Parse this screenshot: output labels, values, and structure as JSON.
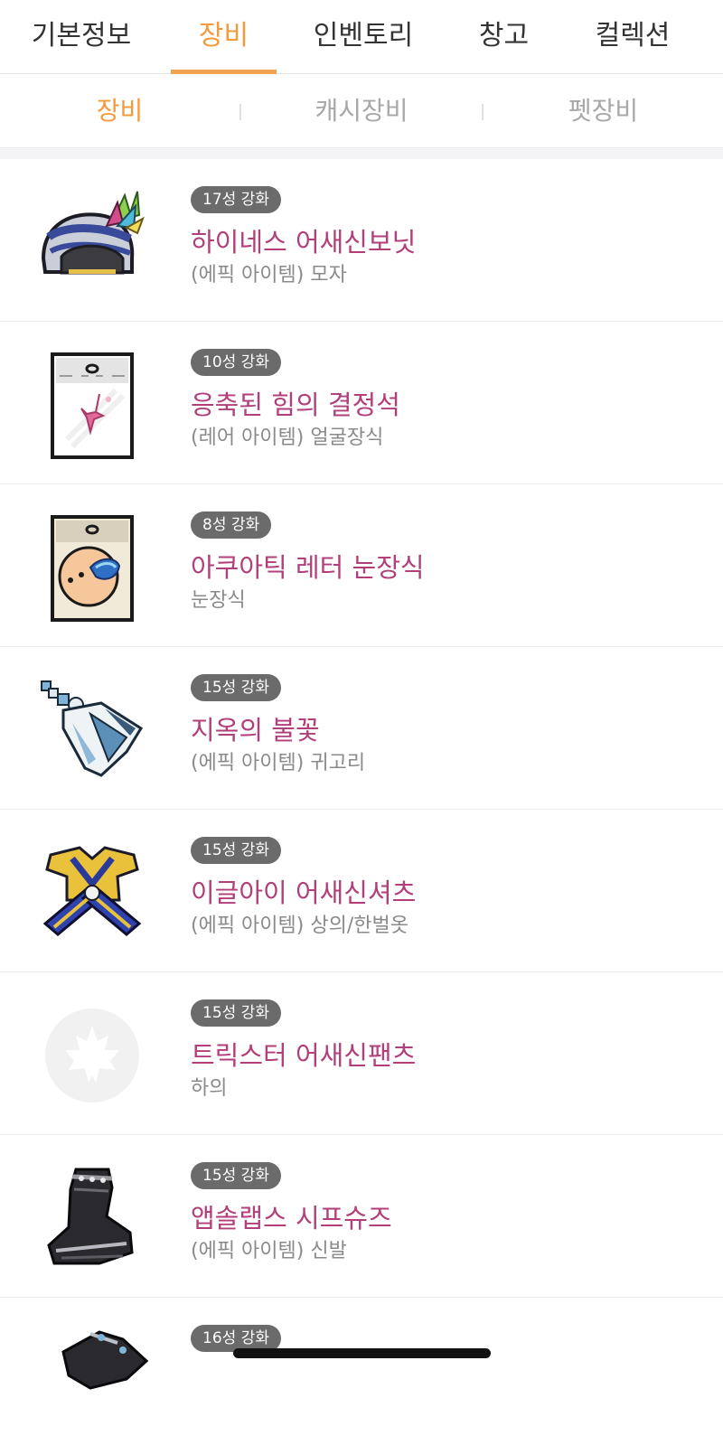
{
  "top_tabs": [
    {
      "label": "기본정보"
    },
    {
      "label": "장비"
    },
    {
      "label": "인벤토리"
    },
    {
      "label": "창고"
    },
    {
      "label": "컬렉션"
    }
  ],
  "top_tabs_active": "장비",
  "sub_tabs": [
    {
      "label": "장비"
    },
    {
      "label": "캐시장비"
    },
    {
      "label": "펫장비"
    }
  ],
  "sub_tabs_active": "장비",
  "items": [
    {
      "badge": "17성 강화",
      "name": "하이네스 어새신보닛",
      "type": "(에픽 아이템) 모자",
      "icon": "helmet-icon"
    },
    {
      "badge": "10성 강화",
      "name": "응축된 힘의 결정석",
      "type": "(레어 아이템) 얼굴장식",
      "icon": "crystal-card-icon"
    },
    {
      "badge": "8성 강화",
      "name": "아쿠아틱 레터 눈장식",
      "type": "눈장식",
      "icon": "eye-accessory-icon"
    },
    {
      "badge": "15성 강화",
      "name": "지옥의 불꽃",
      "type": "(에픽 아이템) 귀고리",
      "icon": "earring-icon"
    },
    {
      "badge": "15성 강화",
      "name": "이글아이 어새신셔츠",
      "type": "(에픽 아이템) 상의/한벌옷",
      "icon": "shirt-icon"
    },
    {
      "badge": "15성 강화",
      "name": "트릭스터 어새신팬츠",
      "type": "하의",
      "icon": "maple-leaf-placeholder-icon"
    },
    {
      "badge": "15성 강화",
      "name": "앱솔랩스 시프슈즈",
      "type": "(에픽 아이템) 신발",
      "icon": "shoes-icon"
    },
    {
      "badge": "16성 강화",
      "name": "",
      "type": "",
      "icon": "gloves-icon"
    }
  ],
  "colors": {
    "accent": "#f39a3b",
    "item_name": "#b23f7a",
    "badge_bg": "#6b6b6b"
  }
}
